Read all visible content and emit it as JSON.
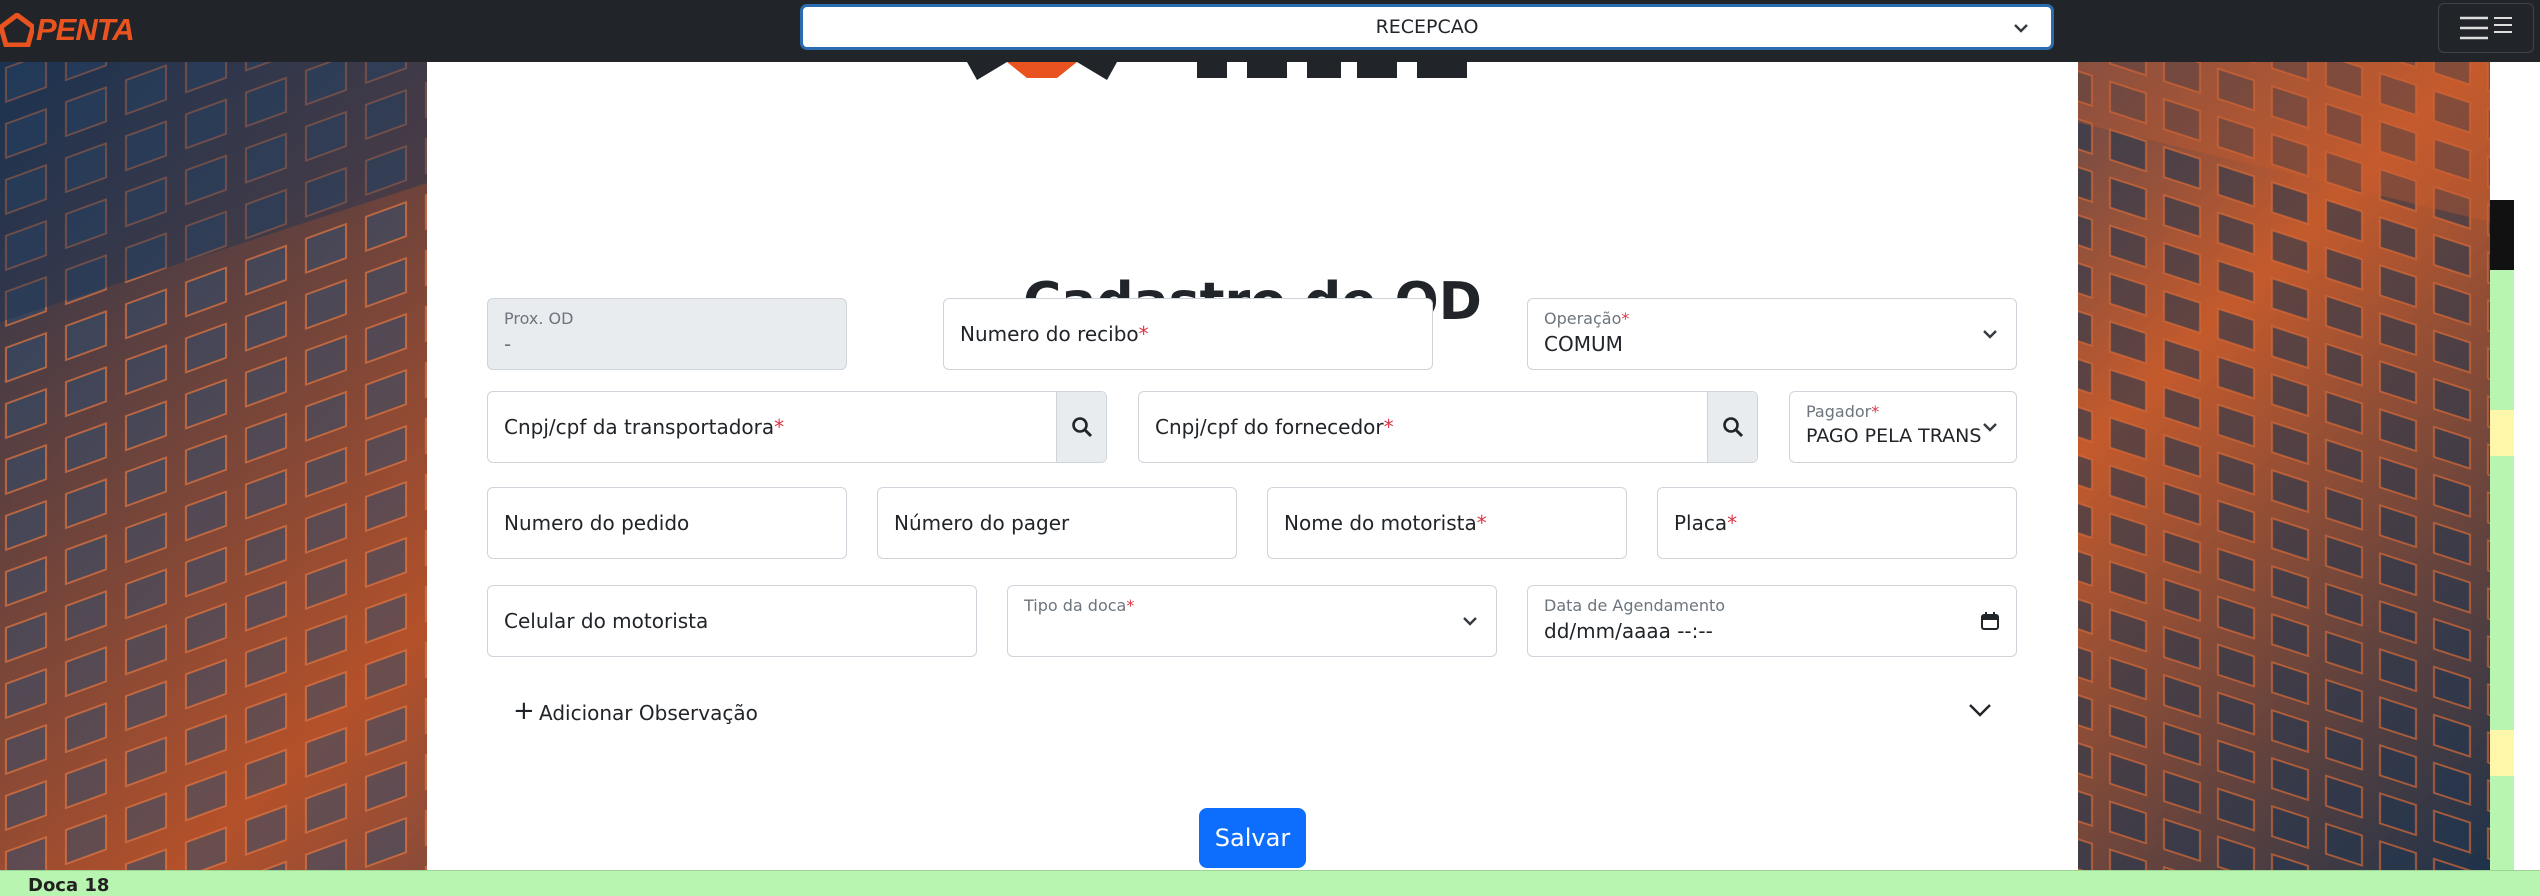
{
  "header": {
    "logo_text": "PENTA",
    "sector_select_value": "RECEPCAO"
  },
  "colors": {
    "brand": "#e8531f",
    "primary": "#0d6efd",
    "navbar": "#212529",
    "required": "#dc3545",
    "green_row": "#b8f5b0",
    "yellow_row": "#fef6a8"
  },
  "form": {
    "title": "Cadastro de OD",
    "prox_od": {
      "label": "Prox. OD",
      "value": "-"
    },
    "numero_recibo": {
      "label": "Numero do recibo",
      "req": "*"
    },
    "operacao": {
      "label": "Operação",
      "req": "*",
      "value": "COMUM"
    },
    "cnpj_transportadora": {
      "label": "Cnpj/cpf da transportadora",
      "req": "*"
    },
    "cnpj_fornecedor": {
      "label": "Cnpj/cpf do fornecedor",
      "req": "*"
    },
    "pagador": {
      "label": "Pagador",
      "req": "*",
      "value": "PAGO PELA TRANS"
    },
    "numero_pedido": {
      "label": "Numero do pedido"
    },
    "numero_pager": {
      "label": "Número do pager"
    },
    "nome_motorista": {
      "label": "Nome do motorista",
      "req": "*"
    },
    "placa": {
      "label": "Placa",
      "req": "*"
    },
    "celular_motorista": {
      "label": "Celular do motorista"
    },
    "tipo_doca": {
      "label": "Tipo da doca",
      "req": "*"
    },
    "data_agendamento": {
      "label": "Data de Agendamento",
      "value": "dd/mm/aaaa --:--"
    },
    "observacao_toggle": {
      "plus": "+",
      "label": "Adicionar Observação"
    },
    "save_label": "Salvar"
  },
  "background_table": {
    "row_label": "Doca 18"
  },
  "icons": [
    "logo-house-icon",
    "chevron-down-icon",
    "hamburger-menu-icon",
    "search-icon",
    "calendar-icon",
    "plus-icon"
  ]
}
